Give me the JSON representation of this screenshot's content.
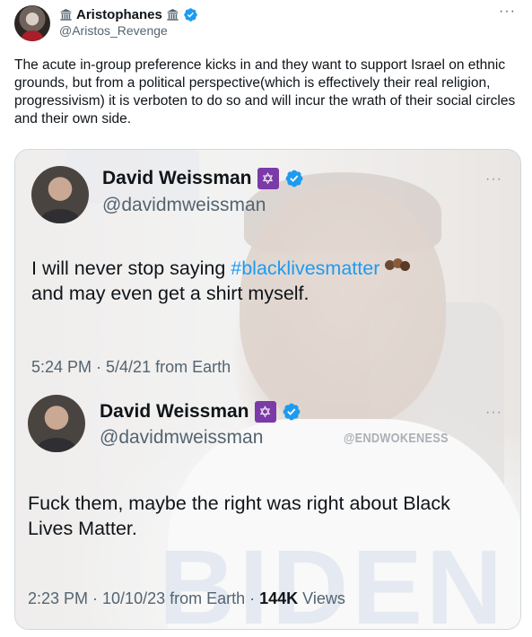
{
  "tweet": {
    "author_name": "Aristophanes",
    "handle": "@Aristos_Revenge",
    "more_label": "···",
    "text": "The acute in-group preference kicks in and they want to support Israel on ethnic grounds, but from a political perspective(which is effectively their real religion, progressivism) it is verboten to do so and will incur the wrath of their social circles and their own side."
  },
  "media": {
    "quoted_1": {
      "name": "David Weissman",
      "handle": "@davidmweissman",
      "more_label": "···",
      "text_before": "I will never stop saying ",
      "hashtag": "#blacklivesmatter",
      "text_after": "and may even get a shirt myself.",
      "meta": "5:24 PM · 5/4/21 from Earth"
    },
    "quoted_2": {
      "name": "David Weissman",
      "handle": "@davidmweissman",
      "more_label": "···",
      "watermark": "@ENDWOKENESS",
      "text": "Fuck them, maybe the right was right about Black Lives Matter.",
      "meta_prefix": "2:23 PM · 10/10/23 from Earth · ",
      "views_count": "144K",
      "views_label": " Views"
    },
    "background_text": "BIDEN"
  },
  "colors": {
    "verified": "#1d9bf0",
    "hashtag": "#1d9bf0",
    "star_badge": "#7b3aa8",
    "secondary_text": "#536471"
  }
}
